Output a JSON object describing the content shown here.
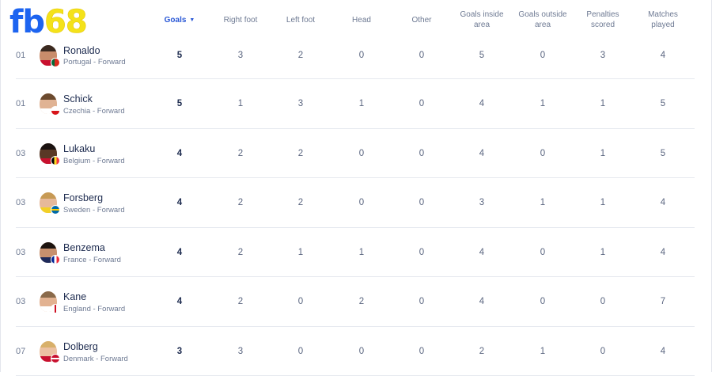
{
  "logo": {
    "part1": "fb",
    "part2": "68"
  },
  "columns": [
    {
      "label": "Goals",
      "sorted": true
    },
    {
      "label": "Right foot"
    },
    {
      "label": "Left foot"
    },
    {
      "label": "Head"
    },
    {
      "label": "Other"
    },
    {
      "label": "Goals inside area"
    },
    {
      "label": "Goals outside area"
    },
    {
      "label": "Penalties scored"
    },
    {
      "label": "Matches played"
    }
  ],
  "sort_indicator": "▼",
  "players": [
    {
      "rank": "01",
      "name": "Ronaldo",
      "meta": "Portugal - Forward",
      "stats": [
        "5",
        "3",
        "2",
        "0",
        "0",
        "5",
        "0",
        "3",
        "4"
      ]
    },
    {
      "rank": "01",
      "name": "Schick",
      "meta": "Czechia - Forward",
      "stats": [
        "5",
        "1",
        "3",
        "1",
        "0",
        "4",
        "1",
        "1",
        "5"
      ]
    },
    {
      "rank": "03",
      "name": "Lukaku",
      "meta": "Belgium - Forward",
      "stats": [
        "4",
        "2",
        "2",
        "0",
        "0",
        "4",
        "0",
        "1",
        "5"
      ]
    },
    {
      "rank": "03",
      "name": "Forsberg",
      "meta": "Sweden - Forward",
      "stats": [
        "4",
        "2",
        "2",
        "0",
        "0",
        "3",
        "1",
        "1",
        "4"
      ]
    },
    {
      "rank": "03",
      "name": "Benzema",
      "meta": "France - Forward",
      "stats": [
        "4",
        "2",
        "1",
        "1",
        "0",
        "4",
        "0",
        "1",
        "4"
      ]
    },
    {
      "rank": "03",
      "name": "Kane",
      "meta": "England - Forward",
      "stats": [
        "4",
        "2",
        "0",
        "2",
        "0",
        "4",
        "0",
        "0",
        "7"
      ]
    },
    {
      "rank": "07",
      "name": "Dolberg",
      "meta": "Denmark - Forward",
      "stats": [
        "3",
        "3",
        "0",
        "0",
        "0",
        "2",
        "1",
        "0",
        "4"
      ]
    }
  ]
}
